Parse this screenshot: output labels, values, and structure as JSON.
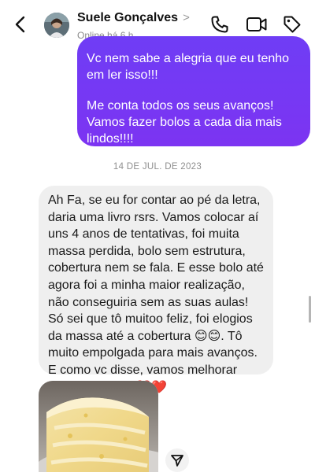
{
  "header": {
    "contact_name": "Suele Gonçalves",
    "chevron": ">",
    "status": "Online há 6 h",
    "icons": [
      "back-arrow-icon",
      "phone-icon",
      "video-call-icon",
      "tag-icon"
    ]
  },
  "messages": {
    "outgoing": {
      "paragraph_1": "Vc nem sabe a alegria que eu tenho em ler isso!!!",
      "paragraph_2": "Me conta todos os seus avanços! Vamos fazer bolos a cada dia mais lindos!!!!"
    },
    "date_separator": "14 DE JUL. DE 2023",
    "incoming": {
      "text_part_1": "Ah Fa, se eu for contar ao pé da letra, daria uma livro rsrs. Vamos colocar aí uns 4 anos de tentativas, foi muita massa perdida, bolo sem estrutura, cobertura nem se fala. E esse bolo até agora foi a minha maior realização, não conseguiria sem as suas aulas! Só sei que tô muitoo feliz, foi elogios da massa até a cobertura ",
      "emoji_smiles": "😊😊",
      "text_part_2": ". Tô muito empolgada para mais avanços. E como vc disse, vamos melhorar cada vez mais! ",
      "emoji_hearts": "❤️❤️"
    },
    "image_message": {
      "icon": "cake-photo"
    }
  },
  "colors": {
    "outgoing_bubble": "#7336f4",
    "incoming_bubble": "#efefef",
    "date_text": "#8e8e8e",
    "status_text": "#8a8a8a"
  }
}
